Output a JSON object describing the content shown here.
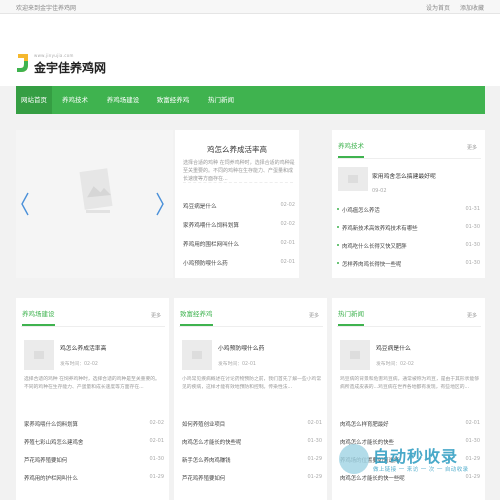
{
  "topbar": {
    "welcome": "欢迎来到金宇佳养鸡网",
    "set_home": "设为首页",
    "add_favorite": "添加收藏"
  },
  "logo": {
    "domain": "www.jinyujia.com",
    "name": "金宇佳养鸡网",
    "icon": "logo-mark-icon"
  },
  "nav": {
    "items": [
      {
        "label": "网站首页"
      },
      {
        "label": "养鸡技术"
      },
      {
        "label": "养鸡场建设"
      },
      {
        "label": "致富经养鸡"
      },
      {
        "label": "热门新闻"
      }
    ]
  },
  "slider": {
    "prev_icon": "chevron-left-icon",
    "next_icon": "chevron-right-icon"
  },
  "featured": {
    "title": "鸡怎么养成活率高",
    "desc": "选择合适的鸡种 在饲养鸡种时，选择合适的鸡种是至关重要的。不同的鸡种在生存能力、产蛋量和成长速度等方面存在...",
    "items": [
      {
        "title": "鸡豆病是什么",
        "date": "02-02"
      },
      {
        "title": "家养鸡喂什么饲料划算",
        "date": "02-02"
      },
      {
        "title": "养鸡用的围栏网叫什么",
        "date": "02-01"
      },
      {
        "title": "小鸡预防喂什么药",
        "date": "02-01"
      }
    ]
  },
  "tech": {
    "title": "养鸡技术",
    "more": "更多",
    "feature_title": "家用鸡舍怎么搞建最好呢",
    "feature_date": "09-02",
    "items": [
      {
        "title": "小鸡瘟怎么养活",
        "date": "01-31"
      },
      {
        "title": "养鸡新技术高效养鸡技术有哪些",
        "date": "01-30"
      },
      {
        "title": "肉鸡吃什么长得又快又肥胖",
        "date": "01-30"
      },
      {
        "title": "怎样养肉鸡长得快一些呢",
        "date": "01-30"
      }
    ]
  },
  "columns": [
    {
      "title": "养鸡场建设",
      "more": "更多",
      "feature_title": "鸡怎么养成活率高",
      "feature_date": "发布时间：02-02",
      "desc": "选择合适的鸡种 在饲养鸡种时，选择合适的鸡种是至关重要的。不同的鸡种在生存能力、产蛋量和成长速度等方面存在...",
      "items": [
        {
          "title": "家养鸡喂什么饲料划算",
          "date": "02-02"
        },
        {
          "title": "养殖七彩山鸡怎么建鸡舍",
          "date": "02-01"
        },
        {
          "title": "芦花鸡养殖要如何",
          "date": "01-30"
        },
        {
          "title": "养鸡用的护栏网叫什么",
          "date": "01-29"
        }
      ]
    },
    {
      "title": "致富经养鸡",
      "more": "更多",
      "feature_title": "小鸡预防喂什么药",
      "feature_date": "发布时间：02-01",
      "desc": "小鸡常见疾病概述在讨论药物预防之前，我们首先了解一些小鸡常见的疾病，这样才能有效地预防和控制。传染性法...",
      "items": [
        {
          "title": "如何养殖创业项目",
          "date": "02-01"
        },
        {
          "title": "肉鸡怎么才能长的快些呢",
          "date": "01-30"
        },
        {
          "title": "新手怎么养肉鸡赚钱",
          "date": "01-29"
        },
        {
          "title": "芦花鸡养殖要如何",
          "date": "01-29"
        }
      ]
    },
    {
      "title": "热门新闻",
      "more": "更多",
      "feature_title": "鸡豆病是什么",
      "feature_date": "发布时间：02-02",
      "desc": "鸡豆病的背景和危害鸡豆病，通常被称为鸡豆，是由于其形状能够病所造成皮表的...鸡豆病在世界各地都有发现，有些地区的...",
      "items": [
        {
          "title": "肉鸡怎么样育肥最好",
          "date": "02-01"
        },
        {
          "title": "肉鸡怎么才能长的快些",
          "date": "01-30"
        },
        {
          "title": "养鸡场的位置要如何选择",
          "date": "01-29"
        },
        {
          "title": "肉鸡怎么才能长的快一些呢",
          "date": "01-29"
        }
      ]
    }
  ],
  "watermark": {
    "text": "自动秒收录",
    "sub": "做上链接 一 来访 一 次 一 自动收录"
  },
  "colors": {
    "accent": "#3fb34f",
    "accent_dark": "#359e43",
    "watermark": "#2a9bc0"
  }
}
